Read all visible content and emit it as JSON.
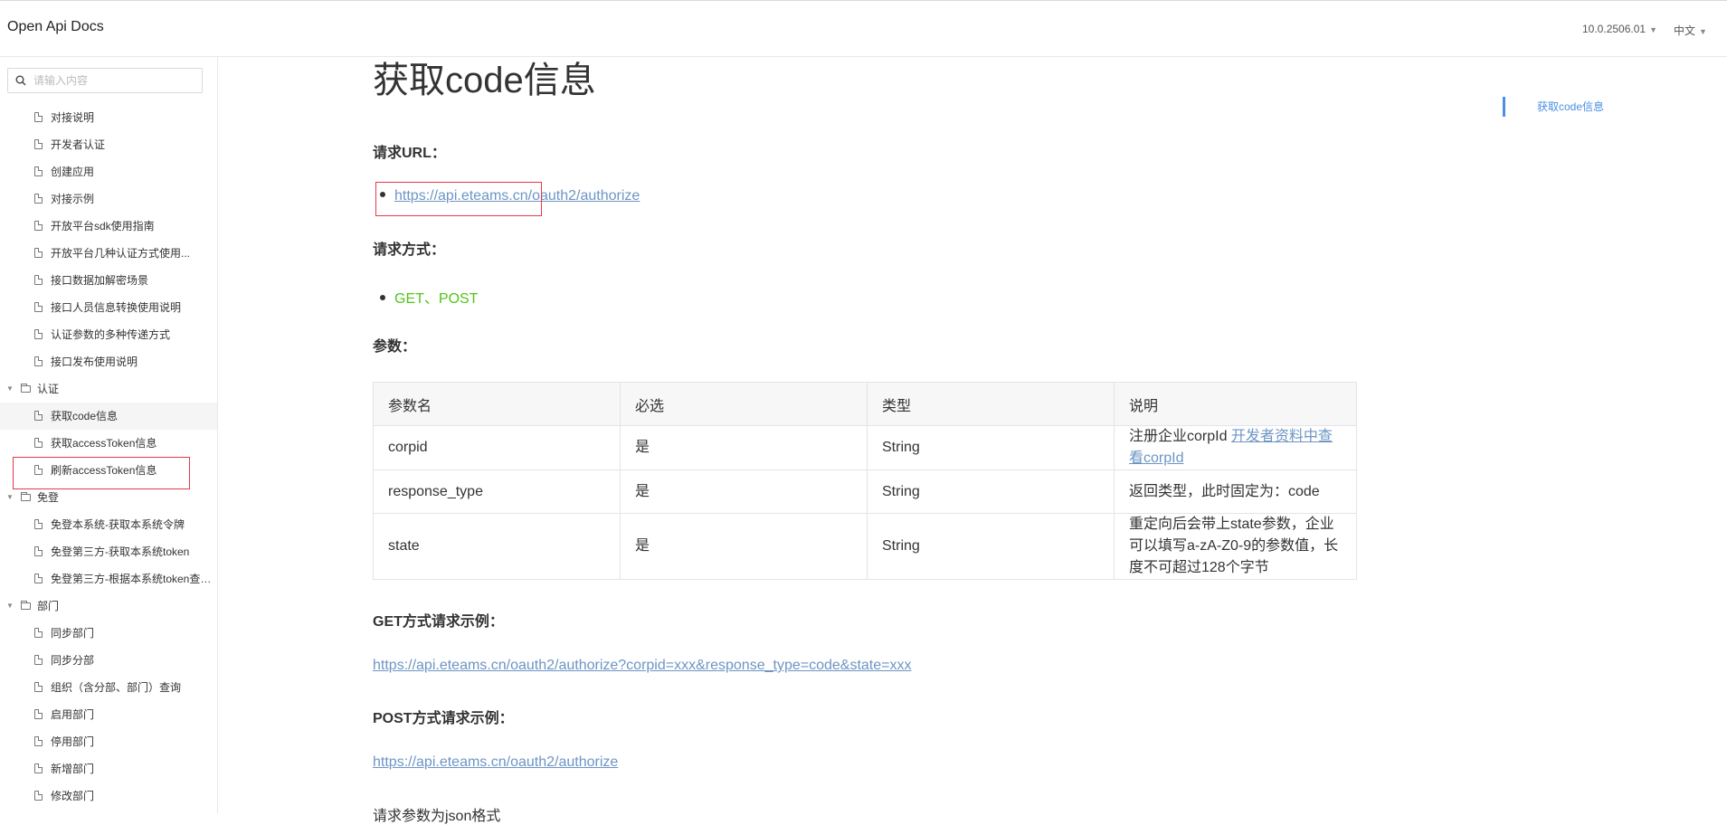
{
  "header": {
    "brand": "Open Api Docs",
    "version": "10.0.2506.01",
    "language": "中文"
  },
  "sidebar": {
    "search_placeholder": "请输入内容",
    "items": [
      {
        "type": "doc",
        "label": "对接说明"
      },
      {
        "type": "doc",
        "label": "开发者认证"
      },
      {
        "type": "doc",
        "label": "创建应用"
      },
      {
        "type": "doc",
        "label": "对接示例"
      },
      {
        "type": "doc",
        "label": "开放平台sdk使用指南"
      },
      {
        "type": "doc",
        "label": "开放平台几种认证方式使用..."
      },
      {
        "type": "doc",
        "label": "接口数据加解密场景"
      },
      {
        "type": "doc",
        "label": "接口人员信息转换使用说明"
      },
      {
        "type": "doc",
        "label": "认证参数的多种传递方式"
      },
      {
        "type": "doc",
        "label": "接口发布使用说明"
      },
      {
        "type": "folder",
        "label": "认证"
      },
      {
        "type": "doc",
        "label": "获取code信息",
        "active": true
      },
      {
        "type": "doc",
        "label": "获取accessToken信息"
      },
      {
        "type": "doc",
        "label": "刷新accessToken信息"
      },
      {
        "type": "folder",
        "label": "免登"
      },
      {
        "type": "doc",
        "label": "免登本系统-获取本系统令牌"
      },
      {
        "type": "doc",
        "label": "免登第三方-获取本系统token"
      },
      {
        "type": "doc",
        "label": "免登第三方-根据本系统token查询..."
      },
      {
        "type": "folder",
        "label": "部门"
      },
      {
        "type": "doc",
        "label": "同步部门"
      },
      {
        "type": "doc",
        "label": "同步分部"
      },
      {
        "type": "doc",
        "label": "组织（含分部、部门）查询"
      },
      {
        "type": "doc",
        "label": "启用部门"
      },
      {
        "type": "doc",
        "label": "停用部门"
      },
      {
        "type": "doc",
        "label": "新增部门"
      },
      {
        "type": "doc",
        "label": "修改部门"
      }
    ]
  },
  "main": {
    "title": "获取code信息",
    "request_url_label": "请求URL：",
    "request_url_host": "https://api.eteams.cn",
    "request_url_path": "/oauth2/authorize",
    "request_method_label": "请求方式：",
    "request_method": "GET、POST",
    "params_label": "参数：",
    "table": {
      "headers": [
        "参数名",
        "必选",
        "类型",
        "说明"
      ],
      "rows": [
        {
          "name": "corpid",
          "required": "是",
          "type": "String",
          "desc": "注册企业corpId ",
          "desc_link": "开发者资料中查看corpId"
        },
        {
          "name": "response_type",
          "required": "是",
          "type": "String",
          "desc": "返回类型，此时固定为：code"
        },
        {
          "name": "state",
          "required": "是",
          "type": "String",
          "desc": "重定向后会带上state参数，企业可以填写a-zA-Z0-9的参数值，长度不可超过128个字节"
        }
      ]
    },
    "get_example_label": "GET方式请求示例：",
    "get_example_url": "https://api.eteams.cn/oauth2/authorize?corpid=xxx&response_type=code&state=xxx",
    "post_example_label": "POST方式请求示例：",
    "post_example_url": "https://api.eteams.cn/oauth2/authorize",
    "post_note": "请求参数为json格式"
  },
  "toc": {
    "items": [
      "获取code信息"
    ]
  },
  "colors": {
    "link": "#6d95c4",
    "method_green": "#52c41a",
    "highlight_red": "#e8374a",
    "toc_blue": "#4a8fe2"
  }
}
